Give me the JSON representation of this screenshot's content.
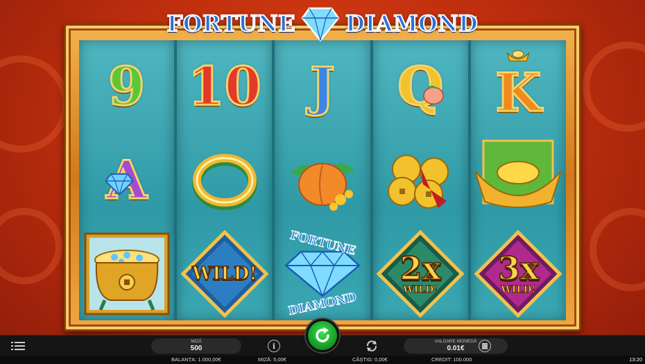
{
  "game": {
    "title_left": "FORTUNE",
    "title_right": "DIAMOND",
    "trademark": "™"
  },
  "reels": [
    {
      "symbols": [
        "9",
        "peach-flower",
        "treasure-pot-icon"
      ]
    },
    {
      "symbols": [
        "10",
        "jade-ring-icon",
        "wild"
      ]
    },
    {
      "symbols": [
        "J",
        "peach-flower-icon",
        "fortune-diamond-scatter"
      ]
    },
    {
      "symbols": [
        "Q",
        "gold-coins-icon",
        "2x-wild"
      ]
    },
    {
      "symbols": [
        "K",
        "gold-ingot-icon",
        "3x-wild"
      ]
    }
  ],
  "symbol_text": {
    "rank_9": "9",
    "rank_10": "10",
    "rank_j": "J",
    "rank_q": "Q",
    "rank_k": "K",
    "rank_a": "A",
    "wild": "WILD!",
    "scatter_top": "FORTUNE",
    "scatter_bottom": "DIAMOND",
    "mult_2": "2x",
    "mult_3": "3x",
    "wild_small": "WILD!"
  },
  "controls": {
    "bet_label": "MIZĂ",
    "bet_value": "500",
    "coin_label": "VALOARE MONEDĂ",
    "coin_value": "0.01€"
  },
  "status": {
    "balance": "BALANȚA: 1.000,00€",
    "bet": "MIZĂ: 5,00€",
    "win": "CÂȘTIG: 0,00€",
    "credit": "CREDIT: 100.000",
    "time": "13:20"
  },
  "colors": {
    "rank_9": "#5cc63a",
    "rank_10": "#e43a2a",
    "rank_j": "#3a86e6",
    "rank_q": "#f2c12e",
    "rank_k": "#f08a1e",
    "rank_a": "#a64bd0",
    "spin": "#22c236"
  }
}
